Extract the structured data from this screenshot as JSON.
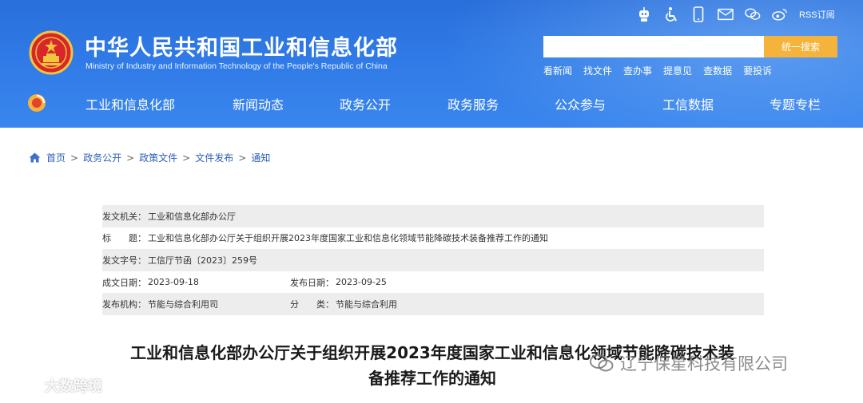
{
  "header": {
    "title": "中华人民共和国工业和信息化部",
    "subtitle": "Ministry of Industry and Information Technology of the People's Republic of China",
    "rss_label": "RSS订阅",
    "search": {
      "placeholder": "",
      "button_label": "统一搜索"
    },
    "quick_links": [
      "看新闻",
      "找文件",
      "查办事",
      "提意见",
      "查数据",
      "要投诉"
    ],
    "nav": [
      "工业和信息化部",
      "新闻动态",
      "政务公开",
      "政务服务",
      "公众参与",
      "工信数据",
      "专题专栏"
    ]
  },
  "breadcrumb": [
    "首页",
    "政务公开",
    "政策文件",
    "文件发布",
    "通知"
  ],
  "meta": {
    "issuer_label": "发文机关：",
    "issuer": "工业和信息化部办公厅",
    "title_label_a": "标",
    "title_label_b": "题：",
    "title": "工业和信息化部办公厅关于组织开展2023年度国家工业和信息化领域节能降碳技术装备推荐工作的通知",
    "doc_no_label": "发文字号：",
    "doc_no": "工信厅节函〔2023〕259号",
    "written_label": "成文日期：",
    "written_date": "2023-09-18",
    "published_label": "发布日期：",
    "published_date": "2023-09-25",
    "org_label": "发布机构：",
    "org": "节能与综合利用司",
    "category_label_a": "分",
    "category_label_b": "类：",
    "category": "节能与综合利用"
  },
  "article": {
    "title_line1": "工业和信息化部办公厅关于组织开展2023年度国家工业和信息化领域节能降碳技术装",
    "title_line2": "备推荐工作的通知"
  },
  "watermarks": {
    "left": "大数跨境",
    "right": "辽宁保星科技有限公司"
  },
  "colors": {
    "header_blue": "#2f7ae6",
    "search_button": "#f6b33c",
    "breadcrumb_link": "#2a5fb8",
    "meta_row_shade": "#ededed"
  }
}
